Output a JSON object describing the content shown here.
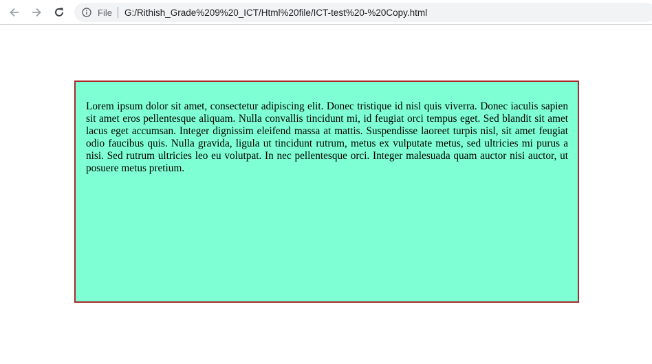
{
  "browser": {
    "scheme_label": "File",
    "url": "G:/Rithish_Grade%209%20_ICT/Html%20file/ICT-test%20-%20Copy.html",
    "icons": {
      "back": "arrow-left-icon",
      "forward": "arrow-right-icon",
      "reload": "reload-icon",
      "info": "info-icon"
    }
  },
  "page": {
    "paragraph": "Lorem ipsum dolor sit amet, consectetur adipiscing elit. Donec tristique id nisl quis viverra. Donec iaculis sapien sit amet eros pellentesque aliquam. Nulla convallis tincidunt mi, id feugiat orci tempus eget. Sed blandit sit amet lacus eget accumsan. Integer dignissim eleifend massa at mattis. Suspendisse laoreet turpis nisl, sit amet feugiat odio faucibus quis. Nulla gravida, ligula ut tincidunt rutrum, metus ex vulputate metus, sed ultricies mi purus a nisi. Sed rutrum ultricies leo eu volutpat. In nec pellentesque orci. Integer malesuada quam auctor nisi auctor, ut posuere metus pretium.",
    "box_background": "#7fffd4",
    "box_border": "#a52a2a"
  }
}
